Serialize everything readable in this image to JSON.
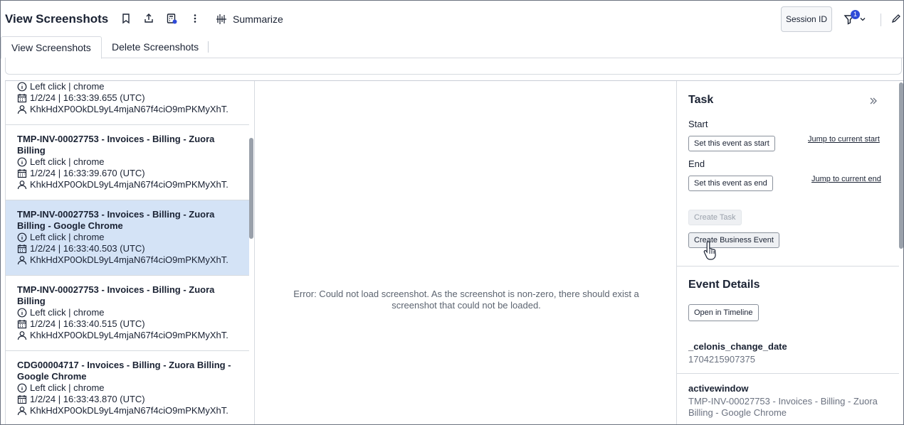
{
  "header": {
    "title": "View Screenshots",
    "icons": [
      "bookmark-icon",
      "share-icon",
      "calculator-icon",
      "more-vertical-icon"
    ],
    "summarize_label": "Summarize",
    "session_label": "Session ID",
    "filter_count": "1"
  },
  "tabs": [
    {
      "label": "View Screenshots",
      "active": true
    },
    {
      "label": "Delete Screenshots",
      "active": false
    }
  ],
  "events": [
    {
      "title": "",
      "action": "Left click | chrome",
      "date": "1/2/24 | 16:33:39.655 (UTC)",
      "user": "KhkHdXP0OkDL9yL4mjaN67f4ciO9mPKMyXhT."
    },
    {
      "title": "TMP-INV-00027753 - Invoices - Billing - Zuora Billing",
      "action": "Left click | chrome",
      "date": "1/2/24 | 16:33:39.670 (UTC)",
      "user": "KhkHdXP0OkDL9yL4mjaN67f4ciO9mPKMyXhT."
    },
    {
      "title": "TMP-INV-00027753 - Invoices - Billing - Zuora Billing - Google Chrome",
      "action": "Left click | chrome",
      "date": "1/2/24 | 16:33:40.503 (UTC)",
      "user": "KhkHdXP0OkDL9yL4mjaN67f4ciO9mPKMyXhT.",
      "selected": true
    },
    {
      "title": "TMP-INV-00027753 - Invoices - Billing - Zuora Billing",
      "action": "Left click | chrome",
      "date": "1/2/24 | 16:33:40.515 (UTC)",
      "user": "KhkHdXP0OkDL9yL4mjaN67f4ciO9mPKMyXhT."
    },
    {
      "title": "CDG00004717 - Invoices - Billing - Zuora Billing - Google Chrome",
      "action": "Left click | chrome",
      "date": "1/2/24 | 16:33:43.870 (UTC)",
      "user": "KhkHdXP0OkDL9yL4mjaN67f4ciO9mPKMyXhT."
    }
  ],
  "viewer": {
    "error": "Error: Could not load screenshot. As the screenshot is non-zero, there should exist a screenshot that could not be loaded."
  },
  "task": {
    "heading": "Task",
    "start_label": "Start",
    "set_start": "Set this event as start",
    "jump_start": "Jump to current start",
    "end_label": "End",
    "set_end": "Set this event as end",
    "jump_end": "Jump to current end",
    "create_task": "Create Task",
    "create_business_event": "Create Business Event"
  },
  "event_details": {
    "heading": "Event Details",
    "open_timeline": "Open in Timeline",
    "fields": [
      {
        "name": "_celonis_change_date",
        "value": "1704215907375"
      },
      {
        "name": "activewindow",
        "value": "TMP-INV-00027753 - Invoices - Billing - Zuora Billing - Google Chrome"
      }
    ]
  },
  "colors": {
    "selected_row": "#d4e3f6",
    "badge": "#2f4bd8",
    "text": "#1a2233"
  }
}
